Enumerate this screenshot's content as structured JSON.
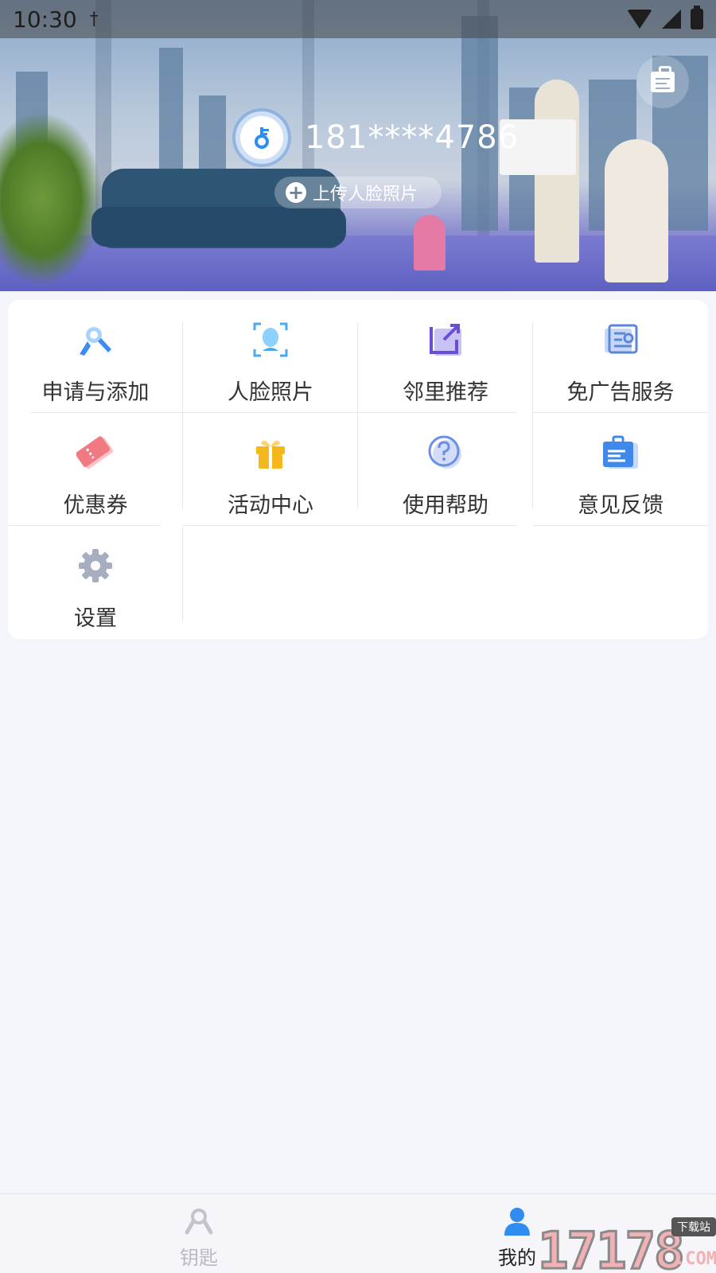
{
  "status_bar": {
    "time": "10:30",
    "extra_icon": "usb-debug-icon",
    "icons": [
      "wifi-icon",
      "signal-icon",
      "battery-charging-icon"
    ]
  },
  "header": {
    "phone": "181****4786",
    "upload_face_label": "上传人脸照片",
    "message_icon": "message-clipboard-icon"
  },
  "menu": {
    "items": [
      {
        "label": "申请与添加",
        "icon": "key-search-icon",
        "color": "#3d8cf2"
      },
      {
        "label": "人脸照片",
        "icon": "face-scan-icon",
        "color": "#4aa8f0"
      },
      {
        "label": "邻里推荐",
        "icon": "share-square-icon",
        "color": "#6a4fd6"
      },
      {
        "label": "免广告服务",
        "icon": "ad-free-scroll-icon",
        "color": "#5d86d8"
      },
      {
        "label": "优惠券",
        "icon": "coupon-ticket-icon",
        "color": "#f07a82"
      },
      {
        "label": "活动中心",
        "icon": "gift-icon",
        "color": "#f5b81c"
      },
      {
        "label": "使用帮助",
        "icon": "help-question-icon",
        "color": "#6a8fe8"
      },
      {
        "label": "意见反馈",
        "icon": "feedback-clipboard-icon",
        "color": "#3f88ec"
      },
      {
        "label": "设置",
        "icon": "gear-icon",
        "color": "#a8adc0"
      }
    ]
  },
  "tabbar": {
    "tabs": [
      {
        "label": "钥匙",
        "icon": "key-tab-icon",
        "active": false
      },
      {
        "label": "我的",
        "icon": "user-tab-icon",
        "active": true
      }
    ]
  },
  "watermark": {
    "text": "17178",
    "tag": "下载站",
    "suffix": ".COM"
  },
  "colors": {
    "accent": "#2f8cf0",
    "background": "#f4f5fb",
    "card": "#ffffff",
    "text": "#333333",
    "inactive_tab": "#b9b9c2"
  }
}
